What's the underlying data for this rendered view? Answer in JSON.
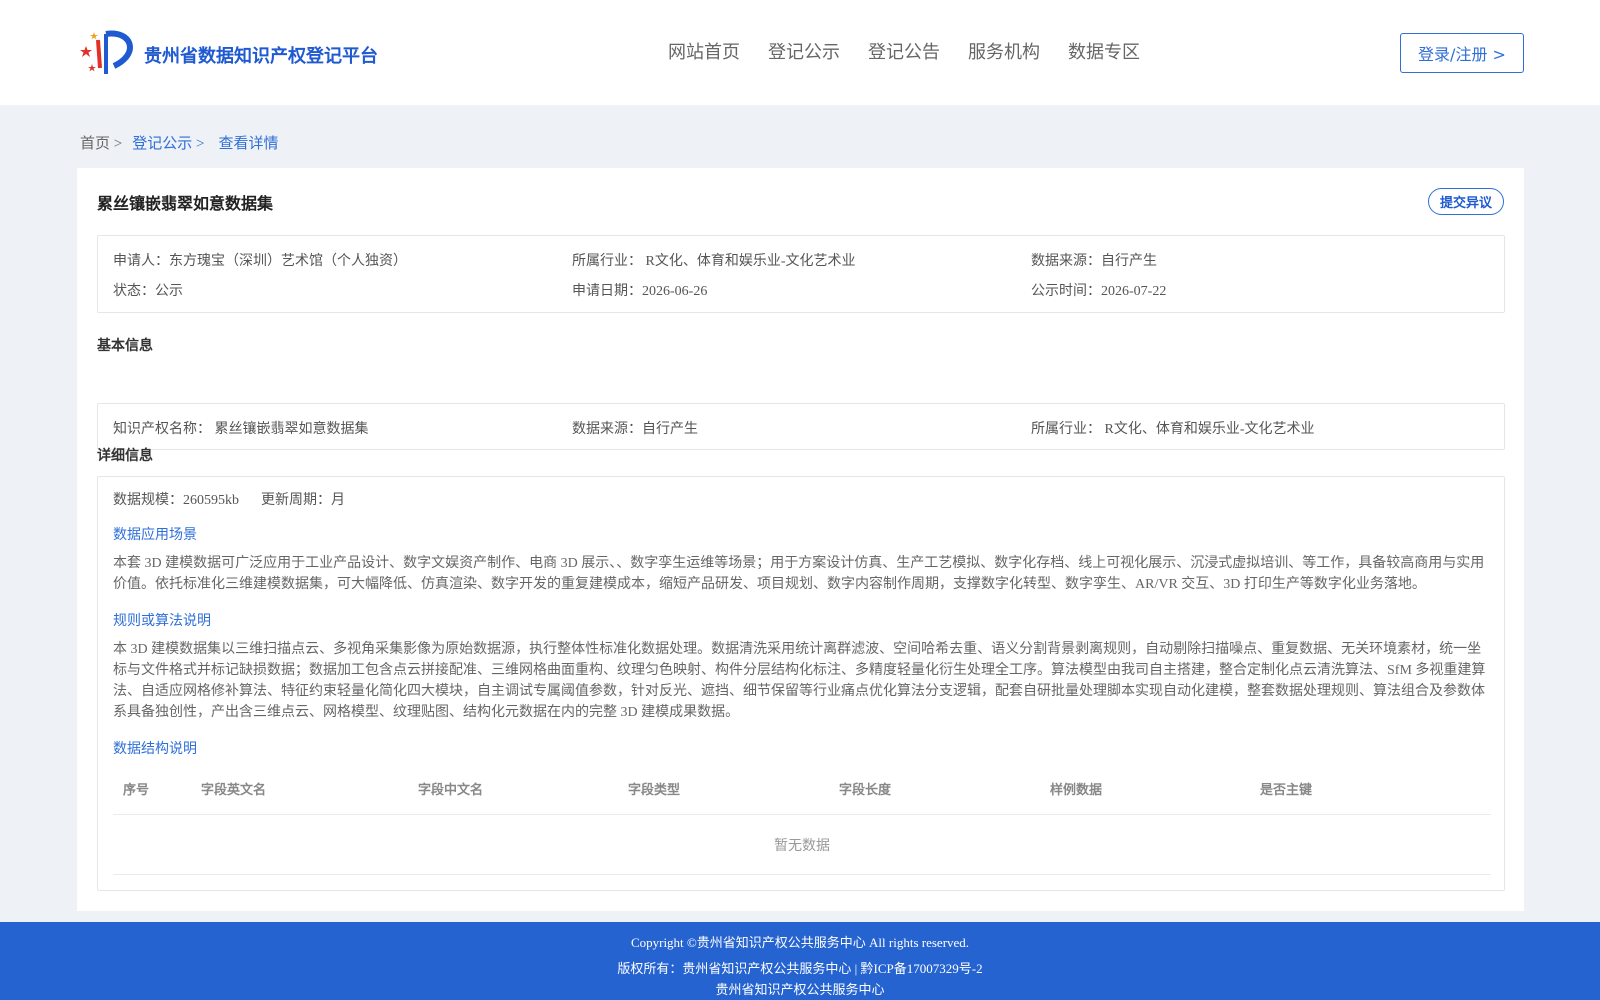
{
  "header": {
    "site_title": "贵州省数据知识产权登记平台",
    "nav": [
      "网站首页",
      "登记公示",
      "登记公告",
      "服务机构",
      "数据专区"
    ],
    "login_label": "登录/注册 >"
  },
  "breadcrumb": {
    "home": "首页 >",
    "list": "登记公示 >",
    "current": "查看详情"
  },
  "record": {
    "title": "累丝镶嵌翡翠如意数据集",
    "objection_label": "提交异议",
    "applicant": "申请人：东方瑰宝（深圳）艺术馆（个人独资）",
    "industry": "所属行业： R文化、体育和娱乐业-文化艺术业",
    "data_source": "数据来源：自行产生",
    "status": "状态：公示",
    "apply_date": "申请日期：2026-06-26",
    "publish_time": "公示时间：2026-07-22"
  },
  "basic_info": {
    "section_title": "基本信息",
    "ip_name": "知识产权名称： 累丝镶嵌翡翠如意数据集",
    "data_source": "数据来源：自行产生",
    "industry": "所属行业： R文化、体育和娱乐业-文化艺术业"
  },
  "detail_info": {
    "section_title": "详细信息",
    "scale": "数据规模：260595kb",
    "update_cycle": "更新周期：月",
    "scenario_title": "数据应用场景",
    "scenario_text": "本套 3D 建模数据可广泛应用于工业产品设计、数字文娱资产制作、电商 3D 展示、、数字孪生运维等场景；用于方案设计仿真、生产工艺模拟、数字化存档、线上可视化展示、沉浸式虚拟培训、等工作，具备较高商用与实用价值。依托标准化三维建模数据集，可大幅降低、仿真渲染、数字开发的重复建模成本，缩短产品研发、项目规划、数字内容制作周期，支撑数字化转型、数字孪生、AR/VR 交互、3D 打印生产等数字化业务落地。",
    "algorithm_title": "规则或算法说明",
    "algorithm_text": "本 3D 建模数据集以三维扫描点云、多视角采集影像为原始数据源，执行整体性标准化数据处理。数据清洗采用统计离群滤波、空间哈希去重、语义分割背景剥离规则，自动剔除扫描噪点、重复数据、无关环境素材，统一坐标与文件格式并标记缺损数据；数据加工包含点云拼接配准、三维网格曲面重构、纹理匀色映射、构件分层结构化标注、多精度轻量化衍生处理全工序。算法模型由我司自主搭建，整合定制化点云清洗算法、SfM 多视重建算法、自适应网格修补算法、特征约束轻量化简化四大模块，自主调试专属阈值参数，针对反光、遮挡、细节保留等行业痛点优化算法分支逻辑，配套自研批量处理脚本实现自动化建模，整套数据处理规则、算法组合及参数体系具备独创性，产出含三维点云、网格模型、纹理贴图、结构化元数据在内的完整 3D 建模成果数据。",
    "structure_title": "数据结构说明",
    "table_headers": [
      "序号",
      "字段英文名",
      "字段中文名",
      "字段类型",
      "字段长度",
      "样例数据",
      "是否主键"
    ],
    "empty_text": "暂无数据"
  },
  "footer": {
    "copyright": "Copyright ©贵州省知识产权公共服务中心 All rights reserved.",
    "rights": "版权所有：贵州省知识产权公共服务中心 | 黔ICP备17007329号-2",
    "org": "贵州省知识产权公共服务中心"
  },
  "colors": {
    "brand_blue": "#2563d1",
    "link_blue": "#2f6fd8",
    "logo_red": "#e0312b"
  }
}
